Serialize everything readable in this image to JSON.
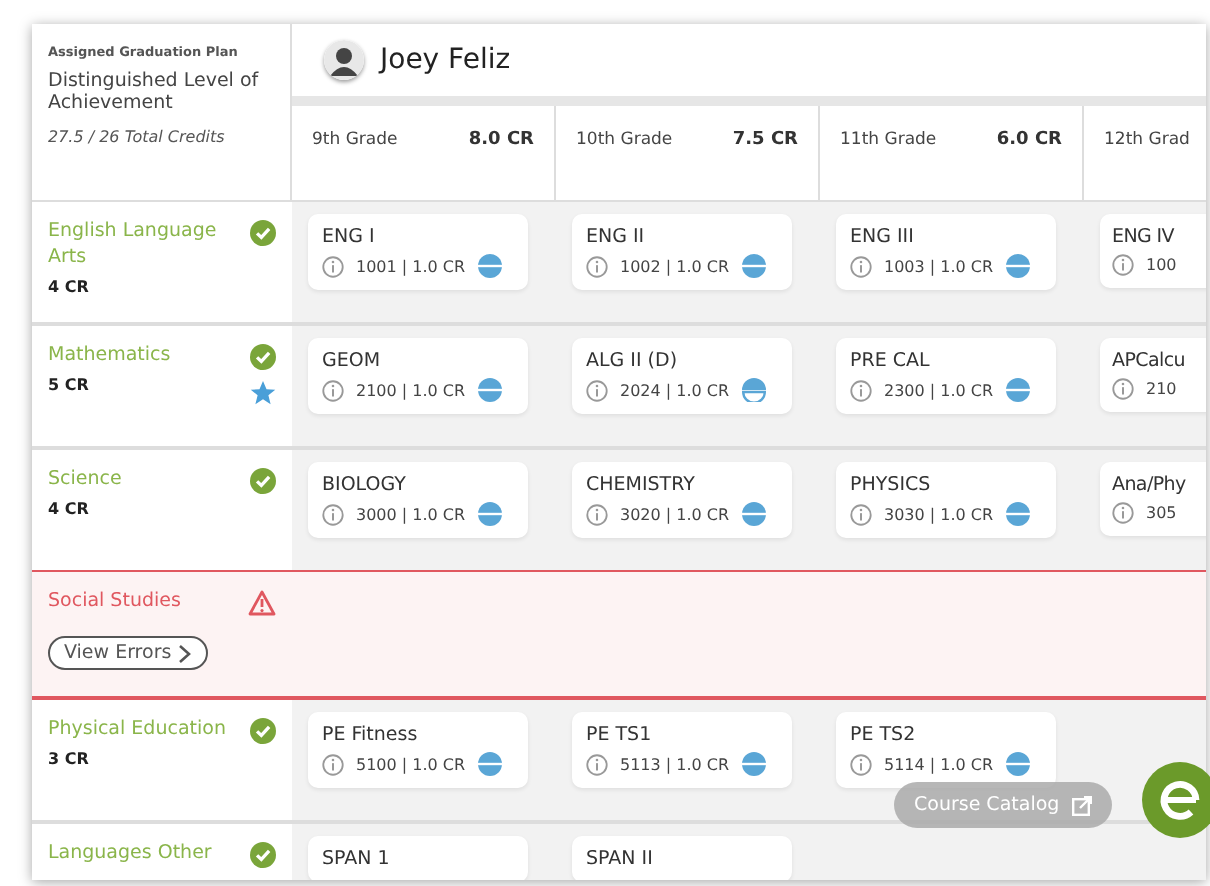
{
  "plan": {
    "label": "Assigned Graduation Plan",
    "name": "Distinguished Level of Achievement",
    "credits": "27.5 / 26 Total Credits"
  },
  "student": {
    "name": "Joey Feliz"
  },
  "grades": [
    {
      "label": "9th Grade",
      "credits": "8.0 CR"
    },
    {
      "label": "10th Grade",
      "credits": "7.5 CR"
    },
    {
      "label": "11th Grade",
      "credits": "6.0 CR"
    },
    {
      "label": "12th Grad"
    }
  ],
  "subjects": [
    {
      "name": "English Language Arts",
      "credits": "4 CR",
      "met": true,
      "starred": false,
      "courses": [
        {
          "name": "ENG I",
          "meta": "1001 | 1.0 CR",
          "completed": true
        },
        {
          "name": "ENG II",
          "meta": "1002 | 1.0 CR",
          "completed": true
        },
        {
          "name": "ENG III",
          "meta": "1003 | 1.0 CR",
          "completed": true
        },
        {
          "name": "ENG IV",
          "meta": "100"
        }
      ]
    },
    {
      "name": "Mathematics",
      "credits": "5 CR",
      "met": true,
      "starred": true,
      "courses": [
        {
          "name": "GEOM",
          "meta": "2100 | 1.0 CR",
          "completed": true
        },
        {
          "name": "ALG II (D)",
          "meta": "2024 | 1.0 CR",
          "completed": false
        },
        {
          "name": "PRE CAL",
          "meta": "2300 | 1.0 CR",
          "completed": true
        },
        {
          "name": "APCalcu",
          "meta": "210"
        }
      ]
    },
    {
      "name": "Science",
      "credits": "4 CR",
      "met": true,
      "starred": false,
      "courses": [
        {
          "name": "BIOLOGY",
          "meta": "3000 | 1.0 CR",
          "completed": true
        },
        {
          "name": "CHEMISTRY",
          "meta": "3020 | 1.0 CR",
          "completed": true
        },
        {
          "name": "PHYSICS",
          "meta": "3030 | 1.0 CR",
          "completed": true
        },
        {
          "name": "Ana/Phy",
          "meta": "305"
        }
      ]
    },
    {
      "name": "Social Studies",
      "met": false,
      "starred": false,
      "action": "View Errors"
    },
    {
      "name": "Physical Education",
      "credits": "3 CR",
      "met": true,
      "starred": false,
      "courses": [
        {
          "name": "PE Fitness",
          "meta": "5100 | 1.0 CR",
          "completed": true
        },
        {
          "name": "PE TS1",
          "meta": "5113 | 1.0 CR",
          "completed": true
        },
        {
          "name": "PE TS2",
          "meta": "5114 | 1.0 CR",
          "completed": true
        }
      ]
    },
    {
      "name": "Languages Other",
      "met": true,
      "starred": false,
      "courses": [
        {
          "name": "SPAN 1"
        },
        {
          "name": "SPAN II"
        }
      ]
    }
  ],
  "catalog_button": "Course Catalog"
}
